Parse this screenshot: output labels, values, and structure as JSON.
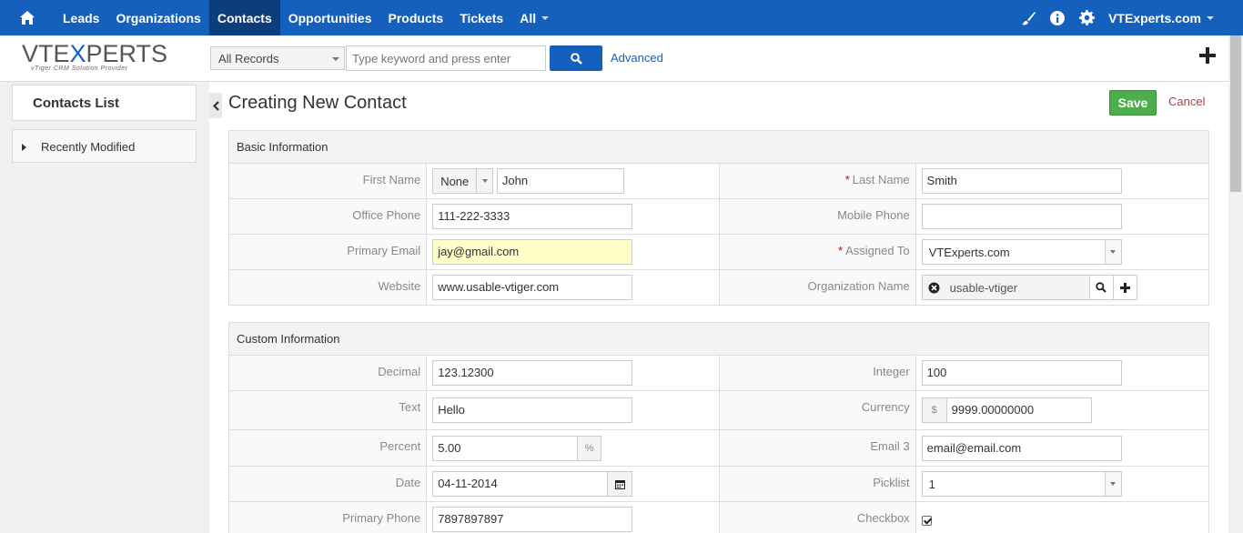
{
  "topnav": {
    "items": [
      "Leads",
      "Organizations",
      "Contacts",
      "Opportunities",
      "Products",
      "Tickets",
      "All"
    ],
    "active": "Contacts",
    "user": "VTExperts.com"
  },
  "logo": {
    "text_a": "VTE",
    "text_x": "X",
    "text_b": "PERTS",
    "tagline": "vTiger CRM Solution Provider"
  },
  "search": {
    "filter": "All Records",
    "placeholder": "Type keyword and press enter",
    "advanced": "Advanced"
  },
  "sidebar": {
    "title": "Contacts List",
    "recent": "Recently Modified"
  },
  "page": {
    "title": "Creating New Contact",
    "save": "Save",
    "cancel": "Cancel"
  },
  "basic": {
    "header": "Basic Information",
    "first_name_label": "First Name",
    "salutation": "None",
    "first_name": "John",
    "last_name_label": "Last Name",
    "last_name": "Smith",
    "office_phone_label": "Office Phone",
    "office_phone": "111-222-3333",
    "mobile_phone_label": "Mobile Phone",
    "mobile_phone": "",
    "primary_email_label": "Primary Email",
    "primary_email": "jay@gmail.com",
    "assigned_to_label": "Assigned To",
    "assigned_to": "VTExperts.com",
    "website_label": "Website",
    "website": "www.usable-vtiger.com",
    "org_name_label": "Organization Name",
    "org_name": "usable-vtiger"
  },
  "custom": {
    "header": "Custom Information",
    "decimal_label": "Decimal",
    "decimal": "123.12300",
    "integer_label": "Integer",
    "integer": "100",
    "text_label": "Text",
    "text": "Hello",
    "currency_label": "Currency",
    "currency_symbol": "$",
    "currency": "9999.00000000",
    "percent_label": "Percent",
    "percent": "5.00",
    "percent_symbol": "%",
    "email3_label": "Email 3",
    "email3": "email@email.com",
    "date_label": "Date",
    "date": "04-11-2014",
    "picklist_label": "Picklist",
    "picklist": "1",
    "primary_phone_label": "Primary Phone",
    "primary_phone": "7897897897",
    "checkbox_label": "Checkbox",
    "checkbox_checked": true
  }
}
